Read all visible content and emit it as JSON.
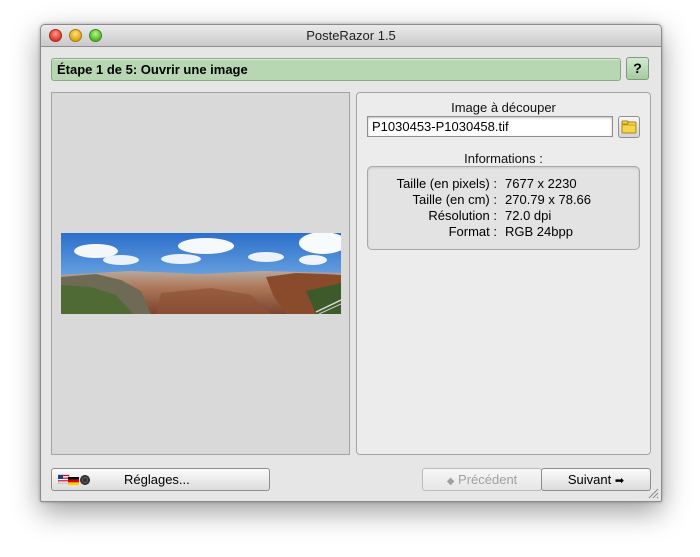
{
  "window": {
    "title": "PosteRazor 1.5"
  },
  "step": {
    "title": "Étape 1 de 5: Ouvrir une image",
    "help_label": "?"
  },
  "source": {
    "section_label": "Image à découper",
    "file_value": "P1030453-P1030458.tif"
  },
  "info": {
    "section_label": "Informations :",
    "rows": [
      {
        "key": "Taille (en pixels) :",
        "value": "7677 x 2230"
      },
      {
        "key": "Taille (en cm) :",
        "value": "270.79 x 78.66"
      },
      {
        "key": "Résolution :",
        "value": "72.0 dpi"
      },
      {
        "key": "Format :",
        "value": "RGB 24bpp"
      }
    ]
  },
  "buttons": {
    "settings_label": "Réglages...",
    "prev_label": "Précédent",
    "next_label": "Suivant"
  },
  "colors": {
    "step_bar": "#b7d7b2",
    "window_bg": "#e6e6e6",
    "preview_bg": "#d9d9d9",
    "disabled_text": "#a0a0a0"
  }
}
